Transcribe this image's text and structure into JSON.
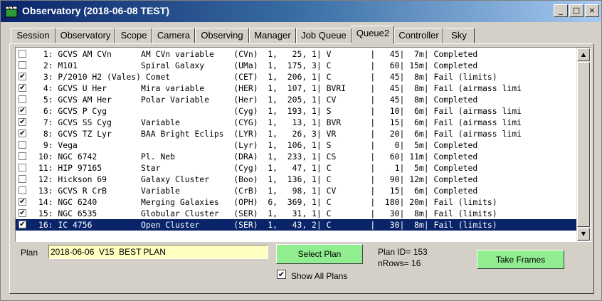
{
  "window": {
    "title": "Observatory (2018-06-08 TEST)",
    "minimize": "_",
    "maximize": "□",
    "close": "×"
  },
  "tabs": [
    {
      "label": "Session"
    },
    {
      "label": "Observatory"
    },
    {
      "label": "Scope"
    },
    {
      "label": "Camera"
    },
    {
      "label": "Observing"
    },
    {
      "label": "Manager"
    },
    {
      "label": "Job Queue"
    },
    {
      "label": "Queue2"
    },
    {
      "label": "Controller"
    },
    {
      "label": "Sky"
    }
  ],
  "active_tab": "Queue2",
  "rows": [
    {
      "checked": false,
      "text": " 1: GCVS AM CVn      AM CVn variable    (CVn)  1,   25, 1| V        |   45|  7m| Completed"
    },
    {
      "checked": false,
      "text": " 2: M101             Spiral Galaxy      (UMa)  1,  175, 3| C        |   60| 15m| Completed"
    },
    {
      "checked": true,
      "text": " 3: P/2010 H2 (Vales) Comet             (CET)  1,  206, 1| C        |   45|  8m| Fail (limits)"
    },
    {
      "checked": true,
      "text": " 4: GCVS U Her       Mira variable      (HER)  1,  107, 1| BVRI     |   45|  8m| Fail (airmass limi"
    },
    {
      "checked": false,
      "text": " 5: GCVS AM Her      Polar Variable     (Her)  1,  205, 1| CV       |   45|  8m| Completed"
    },
    {
      "checked": true,
      "text": " 6: GCVS P Cyg                          (Cyg)  1,  193, 1| S        |   10|  6m| Fail (airmass limi"
    },
    {
      "checked": true,
      "text": " 7: GCVS SS Cyg      Variable           (CYG)  1,   13, 1| BVR      |   15|  6m| Fail (airmass limi"
    },
    {
      "checked": true,
      "text": " 8: GCVS TZ Lyr      BAA Bright Eclips  (LYR)  1,   26, 3| VR       |   20|  6m| Fail (airmass limi"
    },
    {
      "checked": false,
      "text": " 9: Vega                                (Lyr)  1,  106, 1| S        |    0|  5m| Completed"
    },
    {
      "checked": false,
      "text": "10: NGC 6742         Pl. Neb            (DRA)  1,  233, 1| CS       |   60| 11m| Completed"
    },
    {
      "checked": false,
      "text": "11: HIP 97165        Star               (Cyg)  1,   47, 1| C        |    1|  5m| Completed"
    },
    {
      "checked": false,
      "text": "12: Hickson 69       Galaxy Cluster     (Boo)  1,  136, 1| C        |   90| 12m| Completed"
    },
    {
      "checked": false,
      "text": "13: GCVS R CrB       Variable           (CrB)  1,   98, 1| CV       |   15|  6m| Completed"
    },
    {
      "checked": true,
      "text": "14: NGC 6240         Merging Galaxies   (OPH)  6,  369, 1| C        |  180| 20m| Fail (limits)"
    },
    {
      "checked": true,
      "text": "15: NGC 6535         Globular Cluster   (SER)  1,   31, 1| C        |   30|  8m| Fail (limits)"
    },
    {
      "checked": true,
      "text": "16: IC 4756          Open Cluster       (SER)  1,   43, 2| C        |   30|  8m| Fail (limits)",
      "selected": true
    }
  ],
  "scrollbar": {
    "up": "▲",
    "down": "▼"
  },
  "plan": {
    "label": "Plan",
    "value": "2018-06-06  V15  BEST PLAN"
  },
  "select_plan_button": "Select Plan",
  "show_all_plans": {
    "label": "Show All Plans",
    "checked": true,
    "mark": "✔"
  },
  "info": {
    "plan_id": "Plan ID= 153",
    "nrows": "nRows= 16"
  },
  "take_frames_button": "Take Frames",
  "check_mark": "✔"
}
